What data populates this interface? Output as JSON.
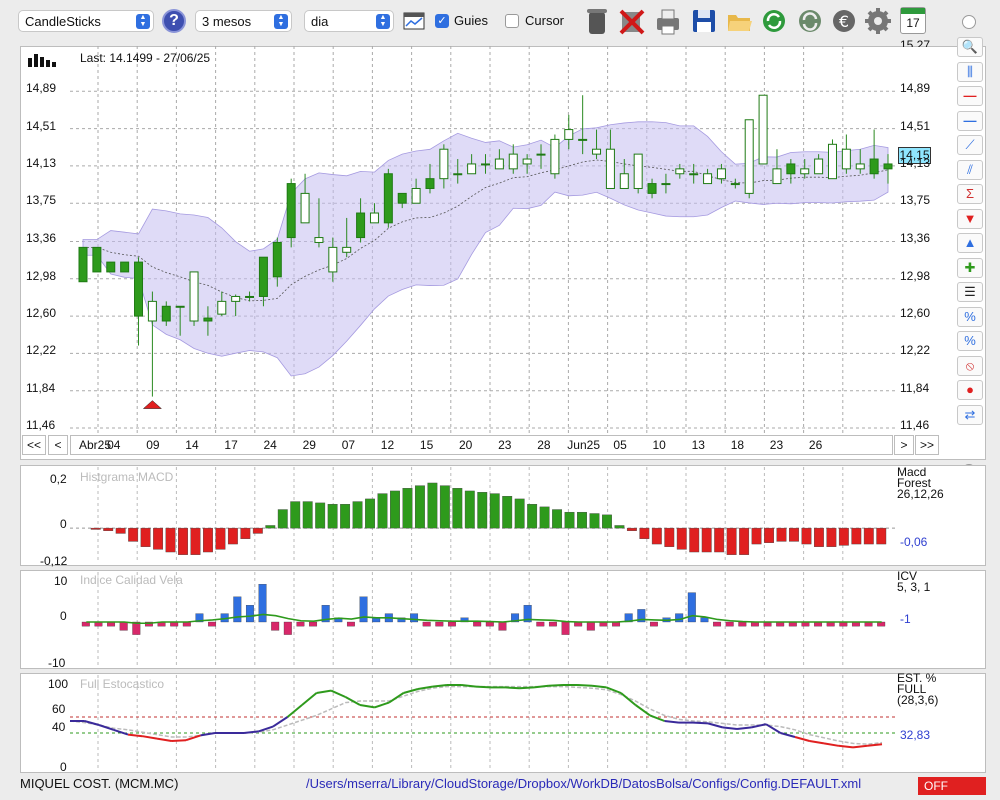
{
  "toolbar": {
    "chart_type": "CandleSticks",
    "period": "3 mesos",
    "interval": "dia",
    "guides_label": "Guies",
    "guides_checked": true,
    "cursor_label": "Cursor",
    "cursor_checked": false,
    "icons": [
      "help-icon",
      "grid-icon",
      "trash-icon",
      "delete-icon",
      "print-icon",
      "save-icon",
      "open-folder-icon",
      "refresh-icon",
      "sync-icon",
      "currency-icon",
      "gear-icon",
      "calendar-icon"
    ],
    "calendar_day": "17"
  },
  "main_chart": {
    "last_label": "Last: 14.1499 - 27/06/25",
    "price_tag": "14,15",
    "y_labels": [
      "14,89",
      "14,51",
      "14,13",
      "13,75",
      "13,36",
      "12,98",
      "12,60",
      "12,22",
      "11,84",
      "11,46"
    ],
    "y_top_partial": "15,27",
    "x_labels": [
      "Abr25",
      "04",
      "09",
      "14",
      "17",
      "24",
      "29",
      "07",
      "12",
      "15",
      "20",
      "23",
      "28",
      "Jun25",
      "05",
      "10",
      "13",
      "18",
      "23",
      "26"
    ],
    "nav": {
      "first": "<<",
      "prev": "<",
      "next": ">",
      "last": ">>"
    }
  },
  "chart_data": [
    {
      "type": "candlestick",
      "title": "Last: 14.1499 - 27/06/25",
      "ylim": [
        11.46,
        15.27
      ],
      "x_labels": [
        "Abr25",
        "04",
        "09",
        "14",
        "17",
        "24",
        "29",
        "07",
        "12",
        "15",
        "20",
        "23",
        "28",
        "Jun25",
        "05",
        "10",
        "13",
        "18",
        "23",
        "26"
      ],
      "candles": [
        {
          "o": 12.95,
          "h": 13.3,
          "l": 12.95,
          "c": 13.3
        },
        {
          "o": 13.05,
          "h": 13.3,
          "l": 13.05,
          "c": 13.3
        },
        {
          "o": 13.05,
          "h": 13.15,
          "l": 13.05,
          "c": 13.15
        },
        {
          "o": 13.05,
          "h": 13.15,
          "l": 13.05,
          "c": 13.15
        },
        {
          "o": 12.6,
          "h": 13.2,
          "l": 12.3,
          "c": 13.15
        },
        {
          "o": 12.75,
          "h": 12.85,
          "l": 11.78,
          "c": 12.55
        },
        {
          "o": 12.55,
          "h": 12.75,
          "l": 12.5,
          "c": 12.7
        },
        {
          "o": 12.7,
          "h": 12.7,
          "l": 12.4,
          "c": 12.7
        },
        {
          "o": 13.05,
          "h": 13.05,
          "l": 12.5,
          "c": 12.55
        },
        {
          "o": 12.55,
          "h": 12.7,
          "l": 12.4,
          "c": 12.58
        },
        {
          "o": 12.75,
          "h": 12.85,
          "l": 12.6,
          "c": 12.62
        },
        {
          "o": 12.8,
          "h": 12.82,
          "l": 12.6,
          "c": 12.75
        },
        {
          "o": 12.8,
          "h": 12.85,
          "l": 12.75,
          "c": 12.8
        },
        {
          "o": 12.8,
          "h": 13.2,
          "l": 12.7,
          "c": 13.2
        },
        {
          "o": 13.0,
          "h": 13.4,
          "l": 12.9,
          "c": 13.35
        },
        {
          "o": 13.4,
          "h": 14.0,
          "l": 13.3,
          "c": 13.95
        },
        {
          "o": 13.85,
          "h": 14.05,
          "l": 13.55,
          "c": 13.55
        },
        {
          "o": 13.4,
          "h": 13.8,
          "l": 13.3,
          "c": 13.35
        },
        {
          "o": 13.3,
          "h": 13.4,
          "l": 12.95,
          "c": 13.05
        },
        {
          "o": 13.3,
          "h": 13.6,
          "l": 13.2,
          "c": 13.25
        },
        {
          "o": 13.4,
          "h": 13.8,
          "l": 13.35,
          "c": 13.65
        },
        {
          "o": 13.65,
          "h": 13.75,
          "l": 13.55,
          "c": 13.55
        },
        {
          "o": 13.55,
          "h": 14.1,
          "l": 13.5,
          "c": 14.05
        },
        {
          "o": 13.75,
          "h": 13.85,
          "l": 13.7,
          "c": 13.85
        },
        {
          "o": 13.9,
          "h": 14.0,
          "l": 13.75,
          "c": 13.75
        },
        {
          "o": 13.9,
          "h": 14.15,
          "l": 13.85,
          "c": 14.0
        },
        {
          "o": 14.3,
          "h": 14.35,
          "l": 13.9,
          "c": 14.0
        },
        {
          "o": 14.05,
          "h": 14.2,
          "l": 13.95,
          "c": 14.05
        },
        {
          "o": 14.15,
          "h": 14.25,
          "l": 14.05,
          "c": 14.05
        },
        {
          "o": 14.15,
          "h": 14.25,
          "l": 14.05,
          "c": 14.15
        },
        {
          "o": 14.2,
          "h": 14.3,
          "l": 14.1,
          "c": 14.1
        },
        {
          "o": 14.25,
          "h": 14.35,
          "l": 14.05,
          "c": 14.1
        },
        {
          "o": 14.2,
          "h": 14.25,
          "l": 14.05,
          "c": 14.15
        },
        {
          "o": 14.25,
          "h": 14.35,
          "l": 14.1,
          "c": 14.25
        },
        {
          "o": 14.4,
          "h": 14.45,
          "l": 14.0,
          "c": 14.05
        },
        {
          "o": 14.5,
          "h": 14.65,
          "l": 14.3,
          "c": 14.4
        },
        {
          "o": 14.4,
          "h": 14.85,
          "l": 14.25,
          "c": 14.4
        },
        {
          "o": 14.3,
          "h": 14.5,
          "l": 14.2,
          "c": 14.25
        },
        {
          "o": 14.3,
          "h": 14.5,
          "l": 14.0,
          "c": 13.9
        },
        {
          "o": 14.05,
          "h": 14.2,
          "l": 13.9,
          "c": 13.9
        },
        {
          "o": 14.25,
          "h": 14.25,
          "l": 13.85,
          "c": 13.9
        },
        {
          "o": 13.85,
          "h": 14.0,
          "l": 13.8,
          "c": 13.95
        },
        {
          "o": 13.95,
          "h": 14.05,
          "l": 13.85,
          "c": 13.95
        },
        {
          "o": 14.1,
          "h": 14.15,
          "l": 14.0,
          "c": 14.05
        },
        {
          "o": 14.05,
          "h": 14.15,
          "l": 13.95,
          "c": 14.05
        },
        {
          "o": 14.05,
          "h": 14.1,
          "l": 13.95,
          "c": 13.95
        },
        {
          "o": 14.1,
          "h": 14.15,
          "l": 13.95,
          "c": 14.0
        },
        {
          "o": 13.95,
          "h": 14.0,
          "l": 13.9,
          "c": 13.95
        },
        {
          "o": 14.6,
          "h": 14.6,
          "l": 13.8,
          "c": 13.85
        },
        {
          "o": 14.85,
          "h": 14.85,
          "l": 14.15,
          "c": 14.15
        },
        {
          "o": 14.1,
          "h": 14.3,
          "l": 13.95,
          "c": 13.95
        },
        {
          "o": 14.05,
          "h": 14.2,
          "l": 13.95,
          "c": 14.15
        },
        {
          "o": 14.1,
          "h": 14.2,
          "l": 14.0,
          "c": 14.05
        },
        {
          "o": 14.2,
          "h": 14.25,
          "l": 14.05,
          "c": 14.05
        },
        {
          "o": 14.35,
          "h": 14.4,
          "l": 14.0,
          "c": 14.0
        },
        {
          "o": 14.3,
          "h": 14.45,
          "l": 14.05,
          "c": 14.1
        },
        {
          "o": 14.15,
          "h": 14.3,
          "l": 14.05,
          "c": 14.1
        },
        {
          "o": 14.05,
          "h": 14.5,
          "l": 14.0,
          "c": 14.2
        },
        {
          "o": 14.1,
          "h": 14.25,
          "l": 13.95,
          "c": 14.15
        }
      ],
      "annotations": [
        {
          "type": "arrow-up",
          "candle": 5,
          "color": "#e02020"
        }
      ]
    },
    {
      "type": "bar",
      "title": "Histgrama MACD",
      "ylim": [
        -0.12,
        0.2
      ],
      "y_labels": [
        "0,2",
        "0",
        "-0,12"
      ],
      "legend": [
        "Macd",
        "Forest",
        "26,12,26"
      ],
      "value_label": "-0,06",
      "values": [
        -0.005,
        -0.01,
        -0.02,
        -0.05,
        -0.07,
        -0.08,
        -0.09,
        -0.1,
        -0.1,
        -0.09,
        -0.08,
        -0.06,
        -0.04,
        -0.02,
        0.01,
        0.07,
        0.1,
        0.1,
        0.095,
        0.09,
        0.09,
        0.1,
        0.11,
        0.13,
        0.14,
        0.15,
        0.16,
        0.17,
        0.16,
        0.15,
        0.14,
        0.135,
        0.13,
        0.12,
        0.11,
        0.09,
        0.08,
        0.07,
        0.06,
        0.06,
        0.055,
        0.05,
        0.01,
        -0.01,
        -0.04,
        -0.06,
        -0.07,
        -0.08,
        -0.09,
        -0.09,
        -0.09,
        -0.1,
        -0.1,
        -0.06,
        -0.055,
        -0.05,
        -0.05,
        -0.06,
        -0.07,
        -0.07,
        -0.065,
        -0.06,
        -0.06,
        -0.06
      ]
    },
    {
      "type": "bar",
      "title": "Indice Calidad Vela",
      "ylim": [
        -10,
        10
      ],
      "y_labels": [
        "10",
        "0",
        "-10"
      ],
      "legend": [
        "ICV",
        "5, 3, 1"
      ],
      "value_label": "-1",
      "values": [
        -1,
        -1,
        -1,
        -2,
        -3,
        -1,
        -1,
        -1,
        -1,
        2,
        -1,
        2,
        6,
        4,
        9,
        -2,
        -3,
        -1,
        -1,
        4,
        1,
        -1,
        6,
        1,
        2,
        1,
        2,
        -1,
        -1,
        -1,
        1,
        -1,
        -1,
        -2,
        2,
        4,
        -1,
        -1,
        -3,
        -1,
        -2,
        -1,
        -1,
        2,
        3,
        -1,
        1,
        2,
        7,
        1,
        -1,
        -1,
        -1,
        -1,
        -1,
        -1,
        -1,
        -1,
        -1,
        -1,
        -1,
        -1,
        -1,
        -1
      ],
      "signal": [
        0,
        0,
        0,
        0,
        -0.3,
        -0.3,
        0,
        0,
        0,
        0.3,
        0.5,
        0.8,
        1.2,
        1.4,
        1.8,
        1.5,
        0.8,
        0.3,
        0.2,
        0.6,
        0.9,
        0.7,
        1.2,
        1.0,
        1.0,
        0.8,
        0.6,
        0.4,
        0.3,
        0.2,
        0.2,
        0.2,
        0.1,
        0,
        0.3,
        0.6,
        0.5,
        0.4,
        0.1,
        0,
        0,
        0,
        0,
        0.2,
        0.6,
        0.5,
        0.4,
        0.6,
        1.5,
        1.2,
        0.6,
        0.3,
        0.1,
        0,
        0,
        0,
        0,
        0,
        0,
        0,
        0,
        0,
        0,
        0
      ]
    },
    {
      "type": "line",
      "title": "Full Estocastico",
      "ylim": [
        0,
        100
      ],
      "y_labels": [
        "100",
        "60",
        "40",
        "0"
      ],
      "legend": [
        "EST. %",
        "FULL",
        "(28,3,6)"
      ],
      "value_label": "32,83",
      "series": [
        {
          "values": [
            55,
            55,
            50,
            44,
            38,
            36,
            33,
            30,
            31,
            37,
            40,
            40,
            40,
            42,
            48,
            60,
            75,
            90,
            93,
            85,
            75,
            72,
            78,
            90,
            95,
            98,
            100,
            100,
            98,
            97,
            97,
            96,
            97,
            99,
            100,
            100,
            99,
            97,
            90,
            75,
            62,
            55,
            53,
            53,
            52,
            47,
            45,
            47,
            51,
            40,
            35,
            30,
            27,
            24,
            22,
            24,
            26
          ]
        },
        {
          "values": [
            55,
            53,
            50,
            46,
            44,
            41,
            38,
            35,
            35,
            37,
            40,
            40,
            40,
            41,
            44,
            50,
            56,
            62,
            70,
            78,
            80,
            80,
            80,
            86,
            92,
            96,
            98,
            98,
            98,
            98,
            98,
            98,
            98,
            98,
            98,
            97,
            96,
            94,
            88,
            80,
            70,
            62,
            57,
            55,
            54,
            52,
            50,
            50,
            50,
            48,
            44,
            38,
            34,
            30,
            27,
            26,
            28
          ]
        }
      ]
    }
  ],
  "statusbar": {
    "ticker": "MIQUEL COST. (MCM.MC)",
    "path": "/Users/mserra/Library/CloudStorage/Dropbox/WorkDB/DatosBolsa/Configs/Config.DEFAULT.xml",
    "off_label": "OFF"
  },
  "colors": {
    "green": "#2e9a1c",
    "red": "#e02020",
    "blue": "#2f6fe0",
    "band": "#c4bef0",
    "pink": "#d8286a",
    "purple": "#3a2a9a"
  }
}
